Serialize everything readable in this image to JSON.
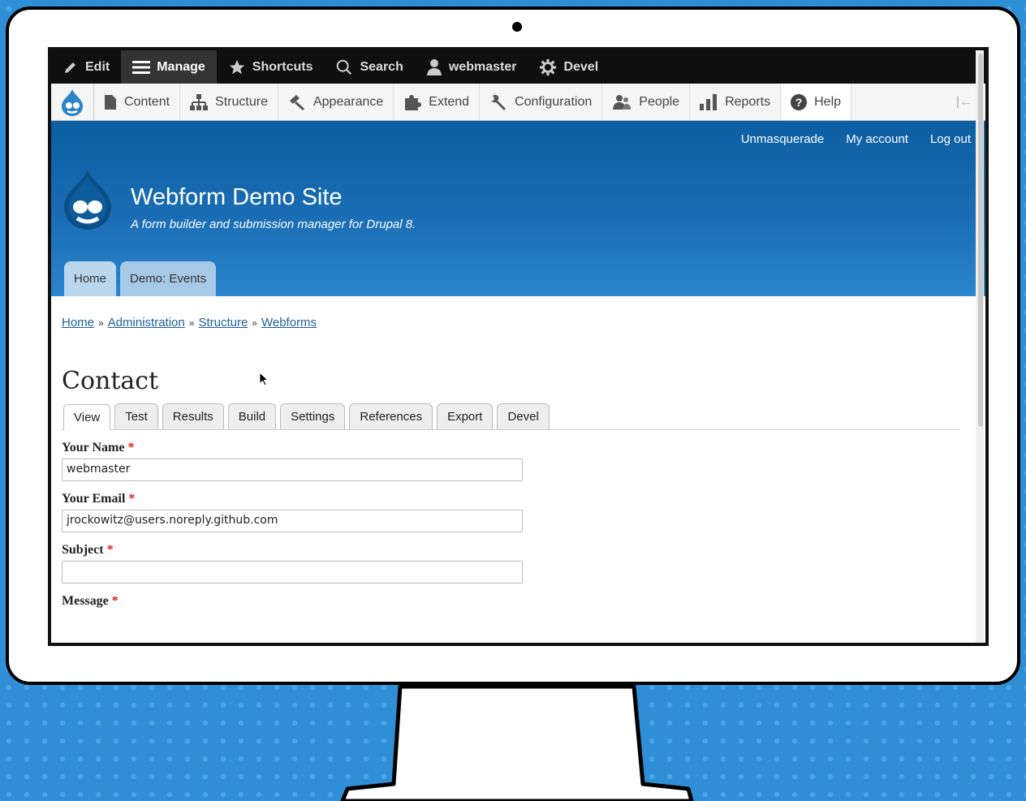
{
  "admin_toolbar": {
    "items": [
      {
        "label": "Edit"
      },
      {
        "label": "Manage"
      },
      {
        "label": "Shortcuts"
      },
      {
        "label": "Search"
      },
      {
        "label": "webmaster"
      },
      {
        "label": "Devel"
      }
    ]
  },
  "tray": {
    "items": [
      {
        "label": "Content"
      },
      {
        "label": "Structure"
      },
      {
        "label": "Appearance"
      },
      {
        "label": "Extend"
      },
      {
        "label": "Configuration"
      },
      {
        "label": "People"
      },
      {
        "label": "Reports"
      },
      {
        "label": "Help"
      }
    ]
  },
  "header": {
    "secondary_menu": [
      "Unmasquerade",
      "My account",
      "Log out"
    ],
    "site_name": "Webform Demo Site",
    "site_slogan": "A form builder and submission manager for Drupal 8.",
    "tabs": [
      "Home",
      "Demo: Events"
    ]
  },
  "breadcrumb": [
    "Home",
    "Administration",
    "Structure",
    "Webforms"
  ],
  "breadcrumb_separator": "»",
  "page_title": "Contact",
  "local_tabs": [
    "View",
    "Test",
    "Results",
    "Build",
    "Settings",
    "References",
    "Export",
    "Devel"
  ],
  "form": {
    "required_marker": "*",
    "fields": [
      {
        "label": "Your Name",
        "value": "webmaster"
      },
      {
        "label": "Your Email",
        "value": "jrockowitz@users.noreply.github.com"
      },
      {
        "label": "Subject",
        "value": ""
      },
      {
        "label": "Message"
      }
    ]
  },
  "colors": {
    "background": "#2f8fd6",
    "toolbar": "#0f0f0f",
    "header_blue": "#1a6db4",
    "link": "#1f5f9a",
    "required": "#dd2222"
  }
}
